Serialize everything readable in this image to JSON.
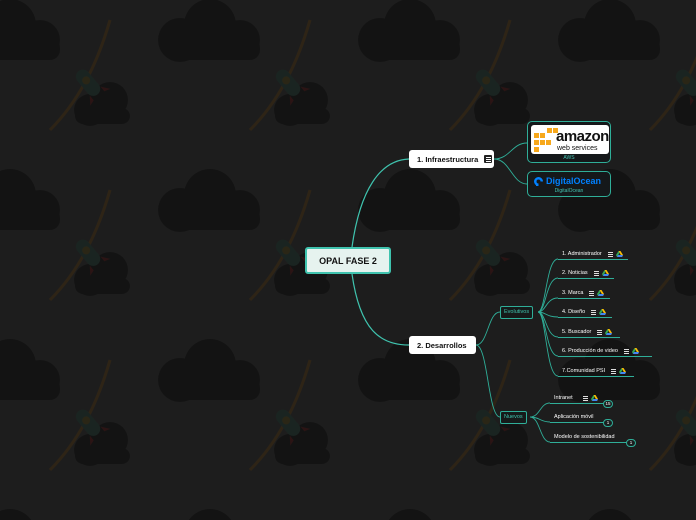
{
  "central": {
    "label": "OPAL FASE 2"
  },
  "branches": {
    "infra": {
      "label": "1. Infraestructura",
      "children": [
        {
          "logo_main": "amazon",
          "logo_sub": "web services",
          "caption": "AWS"
        },
        {
          "logo_main": "DigitalOcean",
          "caption": "DigitalOcean"
        }
      ]
    },
    "dev": {
      "label": "2. Desarrollos",
      "evolutivos": {
        "label": "Evolutivos",
        "items": [
          "1. Administrador",
          "2. Noticias",
          "3. Marca",
          "4. Diseño",
          "5. Buscador",
          "6. Producción de video",
          "7.Comunidad PSI"
        ]
      },
      "nuevos": {
        "label": "Nuevos",
        "items": [
          {
            "label": "Intranet",
            "badge": "15"
          },
          {
            "label": "Aplicación  móvil",
            "badge": "1"
          },
          {
            "label": "Modelo de sostenibilidad",
            "badge": "1"
          }
        ]
      }
    }
  },
  "colors": {
    "accent": "#3fc3ae",
    "background": "#1d1d1d",
    "aws_orange": "#f7a81b",
    "do_blue": "#0080ff"
  }
}
